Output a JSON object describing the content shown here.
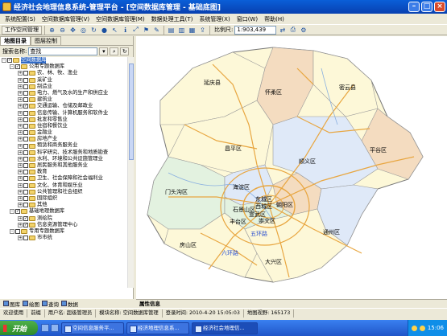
{
  "window": {
    "title": "经济社会地理信息系统-管理平台 - [空间数据库管理 - 基础底图]"
  },
  "menu": [
    "系统配置(S)",
    "空间数据库管理(V)",
    "空间数据库管理(M)",
    "数据处理工具(T)",
    "系统管理(X)",
    "窗口(W)",
    "帮助(H)"
  ],
  "toolbar": {
    "workspace_label": "工作空间管理",
    "scale_label": "比例尺:",
    "scale_value": "1:903,439"
  },
  "left_panel": {
    "tabs": [
      "地图目录",
      "图层控制"
    ],
    "search_label": "搜索名称:",
    "search_value": "查找",
    "tree": [
      {
        "indent": 0,
        "label": "空间数据库",
        "exp": "-",
        "checked": true,
        "selected": true
      },
      {
        "indent": 1,
        "label": "公用专题数据库",
        "exp": "-",
        "checked": true
      },
      {
        "indent": 2,
        "label": "农、林、牧、渔业",
        "exp": "+",
        "checked": false
      },
      {
        "indent": 2,
        "label": "采矿业",
        "exp": "+",
        "checked": false
      },
      {
        "indent": 2,
        "label": "制造业",
        "exp": "+",
        "checked": false
      },
      {
        "indent": 2,
        "label": "电力、燃气及水的生产和供应业",
        "exp": "+",
        "checked": false
      },
      {
        "indent": 2,
        "label": "建筑业",
        "exp": "+",
        "checked": false
      },
      {
        "indent": 2,
        "label": "交通运输、仓储及邮政业",
        "exp": "+",
        "checked": true
      },
      {
        "indent": 2,
        "label": "信息传输、计算机服务和软件业",
        "exp": "+",
        "checked": false
      },
      {
        "indent": 2,
        "label": "批发和零售业",
        "exp": "+",
        "checked": false
      },
      {
        "indent": 2,
        "label": "住宿和餐饮业",
        "exp": "+",
        "checked": false
      },
      {
        "indent": 2,
        "label": "金融业",
        "exp": "+",
        "checked": false
      },
      {
        "indent": 2,
        "label": "房地产业",
        "exp": "+",
        "checked": false
      },
      {
        "indent": 2,
        "label": "租赁和商务服务业",
        "exp": "+",
        "checked": false
      },
      {
        "indent": 2,
        "label": "科学研究、技术服务和地质勘查",
        "exp": "+",
        "checked": false
      },
      {
        "indent": 2,
        "label": "水利、环境和公共设施管理业",
        "exp": "+",
        "checked": false
      },
      {
        "indent": 2,
        "label": "居民服务和其他服务业",
        "exp": "+",
        "checked": false
      },
      {
        "indent": 2,
        "label": "教育",
        "exp": "+",
        "checked": false
      },
      {
        "indent": 2,
        "label": "卫生、社会保障和社会福利业",
        "exp": "+",
        "checked": false
      },
      {
        "indent": 2,
        "label": "文化、体育和娱乐业",
        "exp": "+",
        "checked": false
      },
      {
        "indent": 2,
        "label": "公共管理和社会组织",
        "exp": "+",
        "checked": false
      },
      {
        "indent": 2,
        "label": "国际组织",
        "exp": "+",
        "checked": false
      },
      {
        "indent": 2,
        "label": "其他",
        "exp": "+",
        "checked": false
      },
      {
        "indent": 1,
        "label": "基础地理数据库",
        "exp": "-",
        "checked": true
      },
      {
        "indent": 2,
        "label": "测绘院",
        "exp": "+",
        "checked": true
      },
      {
        "indent": 2,
        "label": "信息资源管理中心",
        "exp": "+",
        "checked": true
      },
      {
        "indent": 1,
        "label": "专用专题数据库",
        "exp": "-",
        "checked": false
      },
      {
        "indent": 2,
        "label": "市市统",
        "exp": "+",
        "checked": false
      }
    ],
    "bottom_tabs": [
      "图库",
      "绘图",
      "查询",
      "数据"
    ]
  },
  "map": {
    "districts": [
      "延庆县",
      "怀柔区",
      "密云县",
      "昌平区",
      "平谷区",
      "顺义区",
      "门头沟区",
      "海淀区",
      "东城区",
      "西城区",
      "朝阳区",
      "石景山区",
      "丰台区",
      "宣武区",
      "崇文区",
      "通州区",
      "房山区",
      "大兴区"
    ],
    "road_labels": [
      "五环路",
      "六环路"
    ],
    "colors": {
      "light_district": "#fdf8d8",
      "light_blue": "#dfe9f8",
      "light_green": "#e3f2e0",
      "tan": "#f4dcc0",
      "road": "#e8a640"
    }
  },
  "statusbar": {
    "title": "属性信息"
  },
  "infobar": {
    "status": "欢迎使用",
    "tab_label": "前缀",
    "user_label": "用户名",
    "user_value": "超级管理员",
    "module_label": "模块名称:",
    "module_value": "空间数据库管理",
    "login_label": "登录时间:",
    "login_value": "2010-4-20 15:05:03",
    "scope_label": "地图视野:",
    "scope_value": "165173"
  },
  "taskbar": {
    "start": "开始",
    "tasks": [
      "空间信息服务平...",
      "经济地理信息系...",
      "经济社会地理信..."
    ],
    "clock": "15:06"
  }
}
